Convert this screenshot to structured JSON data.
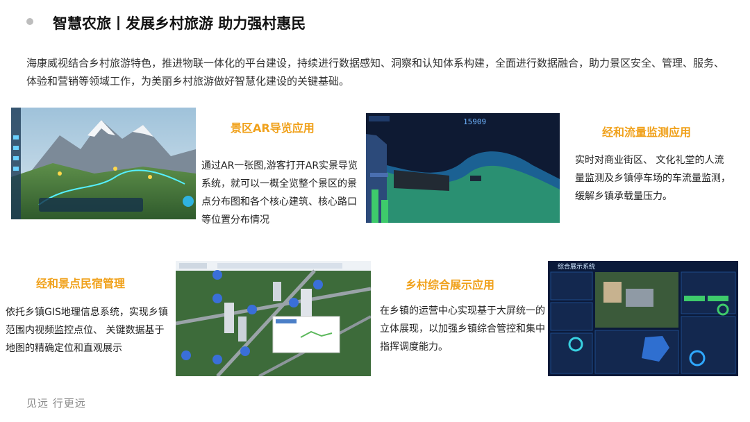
{
  "header": {
    "title": "智慧农旅丨发展乡村旅游  助力强村惠民"
  },
  "intro": "海康威视结合乡村旅游特色，推进物联一体化的平台建设，持续进行数据感知、洞察和认知体系构建，全面进行数据融合，助力景区安全、管理、服务、体验和营销等领域工作，为美丽乡村旅游做好智慧化建设的关键基础。",
  "sections": {
    "ar": {
      "title": "景区AR导览应用",
      "text": "通过AR一张图,游客打开AR实景导览系统，就可以一概全览整个景区的景点分布图和各个核心建筑、核心路口等位置分布情况"
    },
    "flow": {
      "title": "经和流量监测应用",
      "text": "实时对商业街区、 文化礼堂的人流量监测及乡镇停车场的车流量监测，缓解乡镇承载量压力。"
    },
    "homestay": {
      "title": "经和景点民宿管理",
      "text": "依托乡镇GIS地理信息系统，实现乡镇范围内视频监控点位、 关键数据基于 地图的精确定位和直观展示"
    },
    "display": {
      "title": "乡村综合展示应用",
      "text": "在乡镇的运营中心实现基于大屏统一的立体展现，以加强乡镇综合管控和集中指挥调度能力。"
    }
  },
  "screens": {
    "flow_counter": "15909",
    "dashboard_title": "综合展示系统"
  },
  "footer": "见远  行更远",
  "colors": {
    "accent": "#f0a11b",
    "dashboard_bg": "#0b1a3a"
  }
}
